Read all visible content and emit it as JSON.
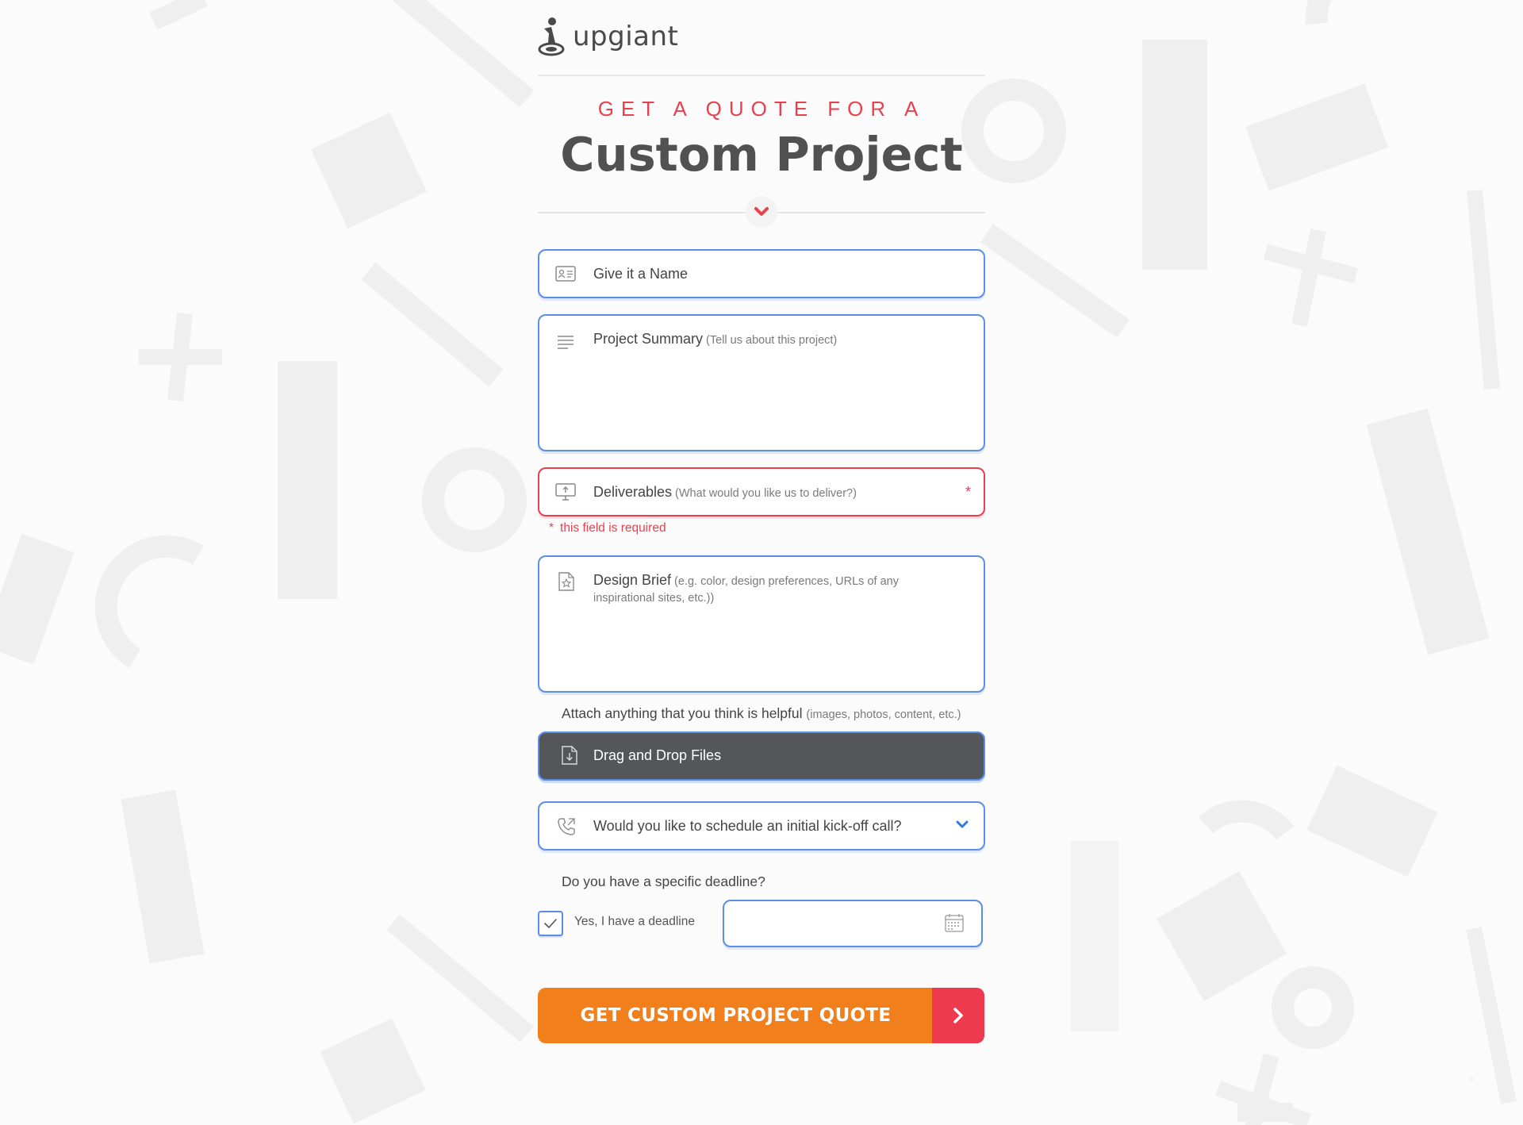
{
  "brand": {
    "name": "upgiant"
  },
  "heading": {
    "kicker": "GET A QUOTE FOR A",
    "title": "Custom Project"
  },
  "form": {
    "name": {
      "label": "Give it a Name"
    },
    "summary": {
      "label": "Project Summary",
      "hint": "(Tell us about this project)"
    },
    "deliverables": {
      "label": "Deliverables",
      "hint": "(What would you like us to deliver?)",
      "required_mark": "*",
      "error": "this field is required",
      "error_mark": "*"
    },
    "brief": {
      "label": "Design Brief",
      "hint": "(e.g. color, design preferences, URLs of any inspirational sites, etc.))"
    },
    "attach": {
      "label": "Attach anything that you think is helpful",
      "hint": "(images, photos, content, etc.)"
    },
    "dropzone": {
      "label": "Drag and Drop Files"
    },
    "kickoff": {
      "selected": "Would you like to schedule an initial kick-off call?"
    },
    "deadline": {
      "question": "Do you have a specific deadline?",
      "checkbox_label": "Yes, I have a deadline",
      "checked": true,
      "date_value": ""
    },
    "submit": {
      "label": "GET CUSTOM PROJECT QUOTE"
    }
  },
  "colors": {
    "accent_blue": "#5b8ee6",
    "error_red": "#e8414d",
    "button_orange": "#f17f1c",
    "button_arrow_red": "#ee3a4f",
    "dropzone_bg": "#54565a"
  },
  "icons": [
    "logo-mark-icon",
    "id-card-icon",
    "lines-icon",
    "monitor-upload-icon",
    "document-star-icon",
    "file-download-icon",
    "phone-icon",
    "chevron-down-icon",
    "check-icon",
    "calendar-icon",
    "chevron-right-icon"
  ]
}
